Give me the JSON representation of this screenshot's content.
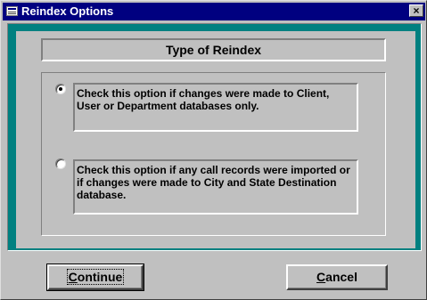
{
  "window": {
    "title": "Reindex Options",
    "close_symbol": "×",
    "icon": "form-icon"
  },
  "header": {
    "label": "Type of Reindex"
  },
  "options": [
    {
      "selected": true,
      "text": "Check this option if changes were made to Client, User or Department databases only."
    },
    {
      "selected": false,
      "text": "Check this option if any call records were imported or if changes were made to City and State Destination database."
    }
  ],
  "buttons": {
    "continue_mnemonic": "C",
    "continue_rest": "ontinue",
    "cancel_mnemonic": "C",
    "cancel_rest": "ancel"
  },
  "colors": {
    "title_bar": "#000080",
    "background": "#008080",
    "face": "#c0c0c0"
  }
}
